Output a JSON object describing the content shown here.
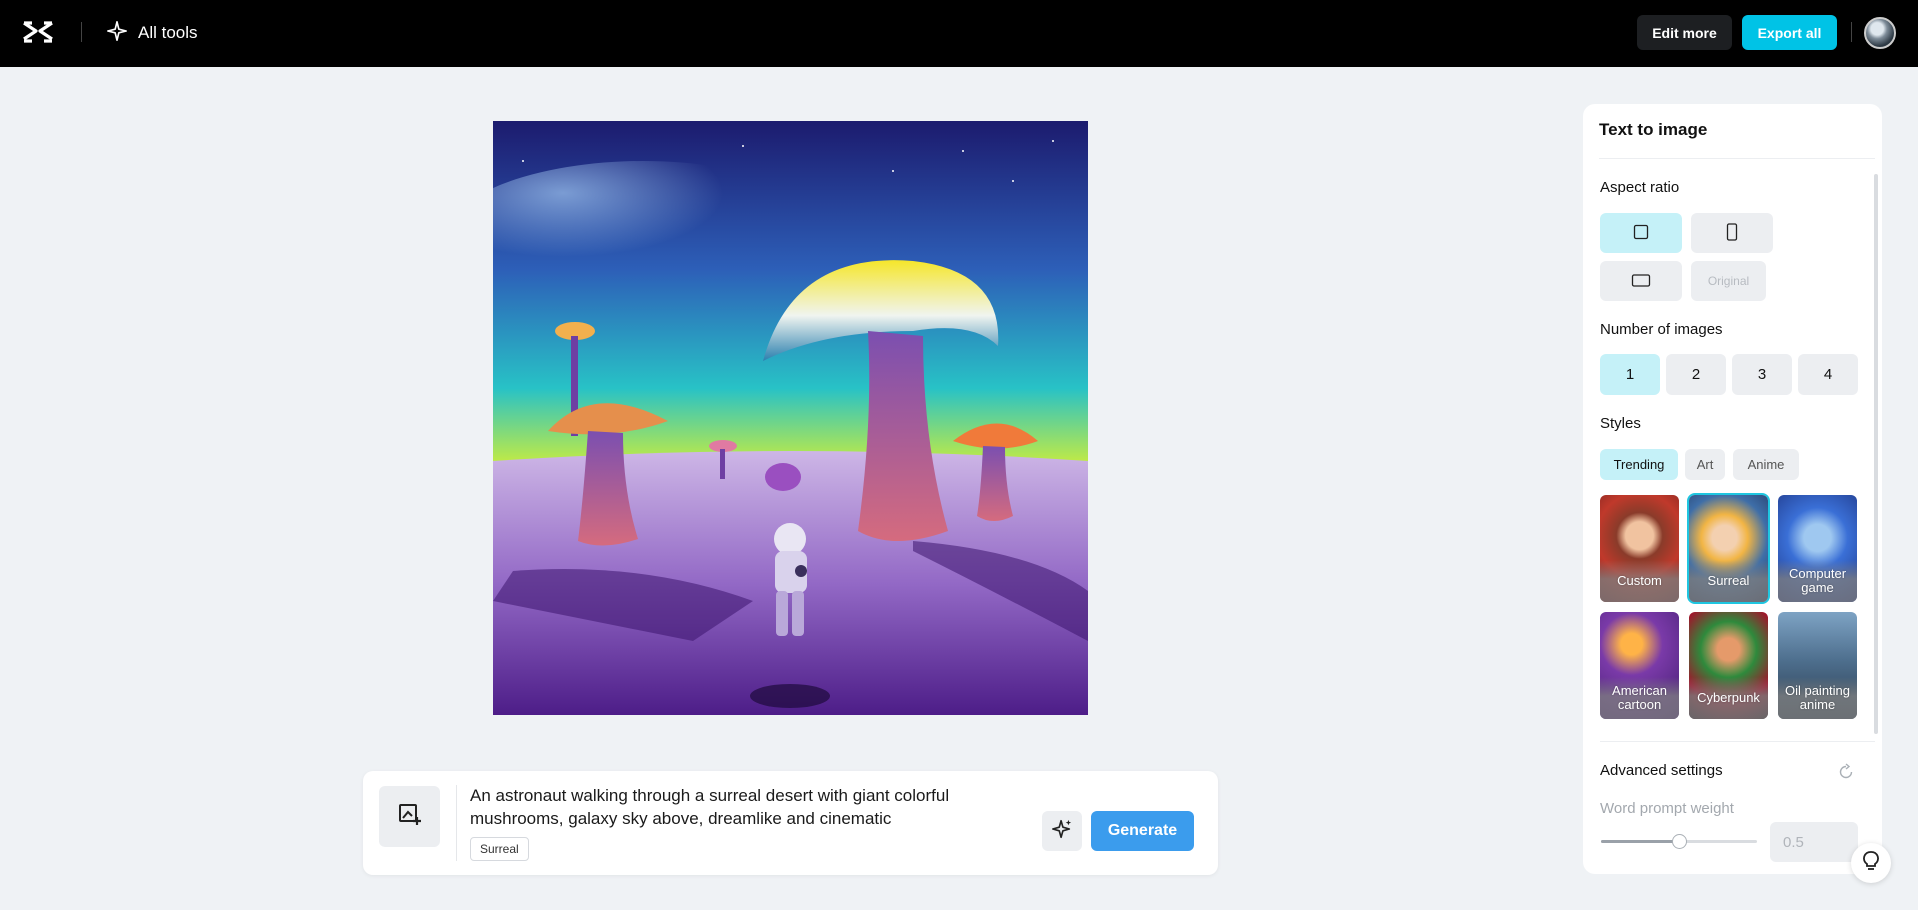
{
  "topbar": {
    "logo_icon": "capcut-logo-icon",
    "all_tools_label": "All tools",
    "edit_more_label": "Edit more",
    "export_all_label": "Export all"
  },
  "prompt": {
    "text": "An astronaut walking through a surreal desert with giant colorful mushrooms, galaxy sky above, dreamlike and cinematic",
    "style_tag": "Surreal",
    "generate_label": "Generate"
  },
  "panel": {
    "title": "Text to image",
    "aspect_ratio_label": "Aspect ratio",
    "aspect_ratios": [
      {
        "name": "square",
        "label": "",
        "selected": true
      },
      {
        "name": "portrait",
        "label": "",
        "selected": false
      },
      {
        "name": "landscape",
        "label": "",
        "selected": false
      },
      {
        "name": "original",
        "label": "Original",
        "selected": false
      }
    ],
    "num_images_label": "Number of images",
    "num_images": [
      "1",
      "2",
      "3",
      "4"
    ],
    "num_images_selected": "1",
    "styles_label": "Styles",
    "style_tabs": [
      "Trending",
      "Art",
      "Anime"
    ],
    "style_tab_selected": "Trending",
    "style_cards": [
      {
        "label": "Custom"
      },
      {
        "label": "Surreal",
        "selected": true
      },
      {
        "label": "Computer game"
      },
      {
        "label": "American cartoon"
      },
      {
        "label": "Cyberpunk"
      },
      {
        "label": "Oil painting anime"
      }
    ],
    "advanced_label": "Advanced settings",
    "word_weight_label": "Word prompt weight",
    "word_weight_value": "0.5",
    "word_weight_fraction": 0.5
  },
  "colors": {
    "accent": "#00c3e6",
    "generate": "#3b9ced",
    "selected_bg": "#c5f1f8"
  }
}
